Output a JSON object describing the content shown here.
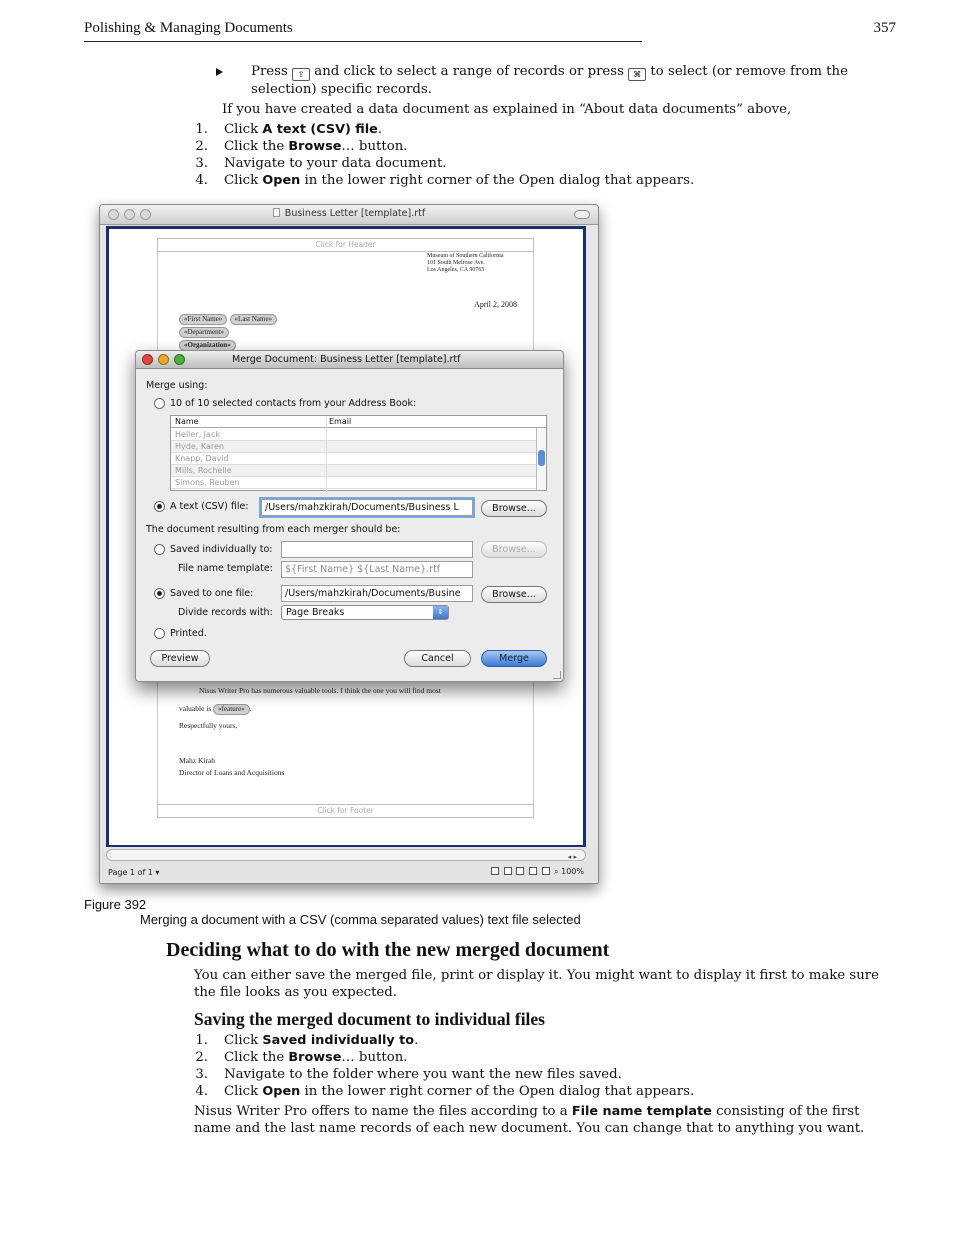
{
  "running_head": {
    "title": "Polishing & Managing Documents",
    "page_number": "357"
  },
  "bullet": {
    "press": "Press",
    "shift_key": "⇧",
    "middle": "and click to select a range of records or press",
    "cmd_key": "⌘",
    "end": "to select (or remove from the",
    "line2": "selection) specific records."
  },
  "intro": "If you have created a data document as explained in “About data documents” above,",
  "steps_a": [
    {
      "num": "1.",
      "pre": "Click ",
      "ui": "A text (CSV) file",
      "post": "."
    },
    {
      "num": "2.",
      "pre": "Click the ",
      "ui": "Browse",
      "post": "… button."
    },
    {
      "num": "3.",
      "pre": "Navigate to your data document.",
      "ui": "",
      "post": ""
    },
    {
      "num": "4.",
      "pre": "Click ",
      "ui": "Open",
      "post": " in the lower right corner of the Open dialog that appears."
    }
  ],
  "window": {
    "title": "Business Letter [template].rtf",
    "header_placeholder": "Click for Header",
    "footer_placeholder": "Click for Footer",
    "address": [
      "Museum of Southern California",
      "101 South Melrose Ave.",
      "Los Angeles, CA 90765"
    ],
    "date": "April 2, 2008",
    "field_first_name": "«First Name»",
    "field_last_name": "«Last Name»",
    "field_department": "«Department»",
    "field_organization": "«Organization»",
    "para1": "Nisus Writer Pro has numerous valuable tools. I think the one you will find most",
    "para2_pre": "valuable is",
    "field_feature": "«feature»",
    "para2_post": ".",
    "closing": "Respectfully yours,",
    "signer": "Mahz Kirah",
    "signer_title": "Director of Loans and Acquisitions",
    "page_indicator": "Page 1 of 1 ▾",
    "zoom": "100%",
    "scroll_arrows": "◂ ▸"
  },
  "dialog": {
    "title": "Merge Document: Business Letter [template].rtf",
    "merge_using": "Merge using:",
    "option_address_book": "10 of 10 selected contacts from your Address Book:",
    "col_name": "Name",
    "col_email": "Email",
    "contacts": [
      "Heller, Jack",
      "Hyde, Karen",
      "Knapp, David",
      "Mills, Rochelle",
      "Simons, Reuben"
    ],
    "option_csv": "A text (CSV) file:",
    "csv_path": "/Users/mahzkirah/Documents/Business L",
    "browse": "Browse...",
    "result_label": "The document resulting from each merger should be:",
    "option_saved_individually": "Saved individually to:",
    "individual_path": "",
    "file_name_template_label": "File name template:",
    "file_name_template_value": "${First Name} ${Last Name}.rtf",
    "option_saved_one": "Saved to one file:",
    "one_file_path": "/Users/mahzkirah/Documents/Busine",
    "divide_label": "Divide records with:",
    "divide_value": "Page Breaks",
    "option_printed": "Printed.",
    "preview": "Preview",
    "cancel": "Cancel",
    "merge": "Merge"
  },
  "figure": {
    "label": "Figure 392",
    "caption": "Merging a document with a CSV (comma separated values) text file selected"
  },
  "section": {
    "heading": "Deciding what to do with the new merged document",
    "paragraph": "You can either save the merged file, print or display it. You might want to display it first to make sure the file looks as you expected."
  },
  "subsection": {
    "heading": "Saving the merged document to individual files"
  },
  "steps_b": [
    {
      "num": "1.",
      "pre": "Click ",
      "ui": "Saved individually to",
      "post": "."
    },
    {
      "num": "2.",
      "pre": "Click the ",
      "ui": "Browse",
      "post": "… button."
    },
    {
      "num": "3.",
      "pre": "Navigate to the folder where you want the new files saved.",
      "ui": "",
      "post": ""
    },
    {
      "num": "4.",
      "pre": "Click ",
      "ui": "Open",
      "post": " in the lower right corner of the Open dialog that appears."
    }
  ],
  "closing_para": {
    "pre": "Nisus Writer Pro offers to name the files according to a ",
    "ui": "File name template",
    "post": " consisting of the first name and the last name records of each new document. You can change that to anything you want."
  },
  "colors": {
    "accent_blue": "#3d7ad4",
    "doc_frame": "#1a2f6e",
    "traffic_red": "#e0443e",
    "traffic_yellow": "#e6a92b",
    "traffic_green": "#4cae3c"
  }
}
